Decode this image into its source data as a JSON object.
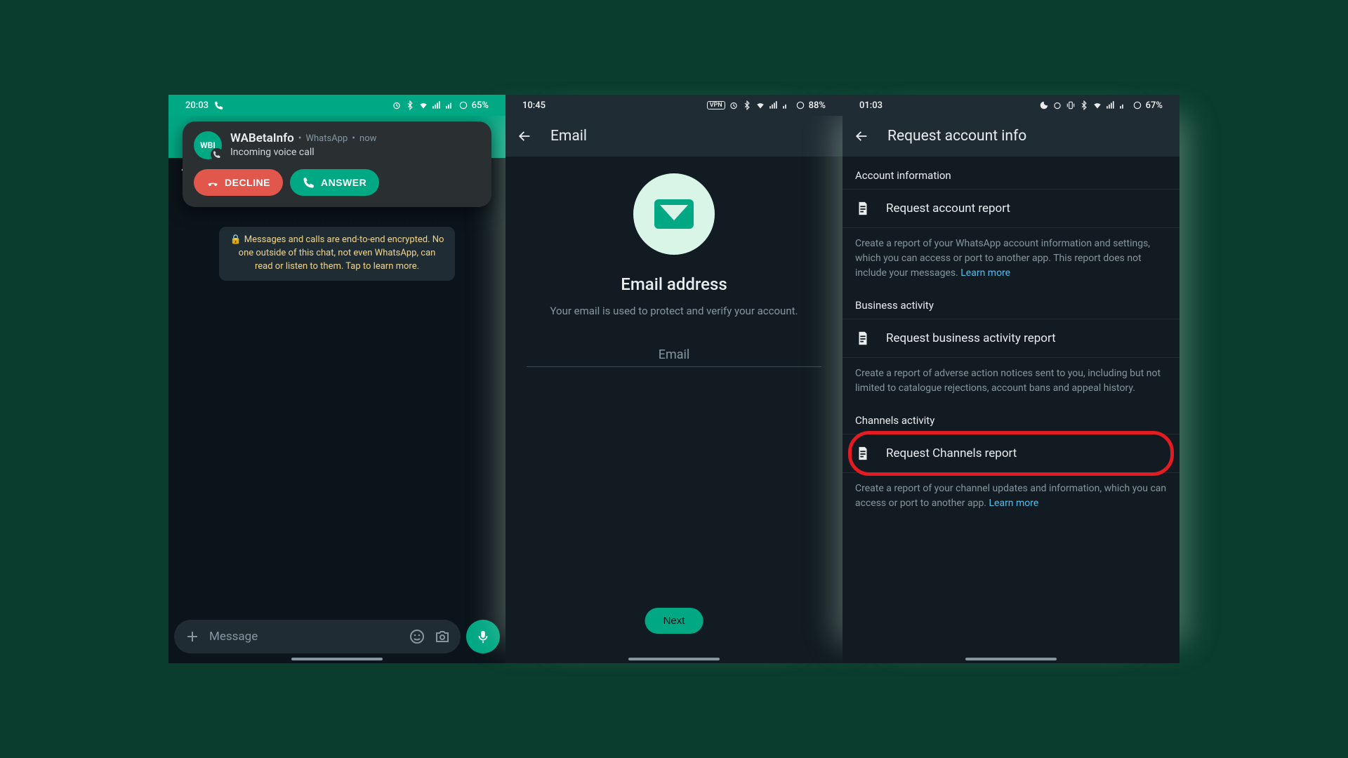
{
  "phone1": {
    "status": {
      "time": "20:03",
      "battery": "65%"
    },
    "call": {
      "caller": "WABetaInfo",
      "app": "WhatsApp",
      "when": "now",
      "subtitle": "Incoming voice call",
      "decline": "DECLINE",
      "answer": "ANSWER",
      "avatar_text": "WBI"
    },
    "encryption": "Messages and calls are end-to-end encrypted. No one outside of this chat, not even WhatsApp, can read or listen to them. Tap to learn more.",
    "composer": {
      "placeholder": "Message"
    }
  },
  "phone2": {
    "status": {
      "time": "10:45",
      "battery": "88%"
    },
    "appbar": "Email",
    "heading": "Email address",
    "sub": "Your email is used to protect and verify your account.",
    "input_placeholder": "Email",
    "next": "Next"
  },
  "phone3": {
    "status": {
      "time": "01:03",
      "battery": "67%"
    },
    "appbar": "Request account info",
    "sections": {
      "account": {
        "label": "Account information",
        "item": "Request account report",
        "desc": "Create a report of your WhatsApp account information and settings, which you can access or port to another app. This report does not include your messages. ",
        "learn": "Learn more"
      },
      "business": {
        "label": "Business activity",
        "item": "Request business activity report",
        "desc": "Create a report of adverse action notices sent to you, including but not limited to catalogue rejections, account bans and appeal history."
      },
      "channels": {
        "label": "Channels activity",
        "item": "Request Channels report",
        "desc": "Create a report of your channel updates and information, which you can access or port to another app. ",
        "learn": "Learn more"
      }
    }
  }
}
